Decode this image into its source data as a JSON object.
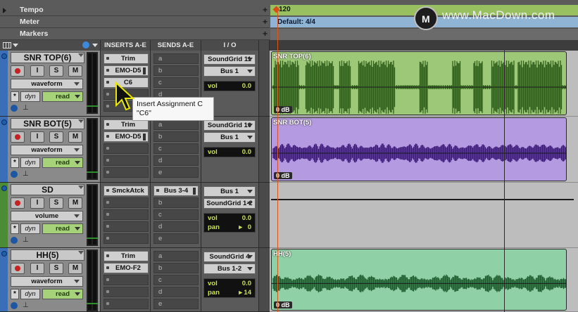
{
  "ruler": {
    "rows": [
      {
        "label": "Tempo"
      },
      {
        "label": "Meter"
      },
      {
        "label": "Markers"
      }
    ],
    "tempo_value": "120",
    "meter_value": "Default: 4/4",
    "add_glyph": "+"
  },
  "watermark": {
    "logo_letter": "M",
    "text": "www.MacDown.com"
  },
  "columns": {
    "inserts": "INSERTS A-E",
    "sends": "SENDS A-E",
    "io": "I / O"
  },
  "tracks": [
    {
      "name": "SNR TOP(6)",
      "color": "#3a6fb8",
      "view": "waveform",
      "dyn": "dyn",
      "automation": "read",
      "inserts": [
        "Trim",
        "EMO-D5",
        "C6",
        "",
        ""
      ],
      "sends": [
        "a",
        "b",
        "c",
        "d",
        "e"
      ],
      "io": [
        "SoundGrid 11",
        "Bus 1"
      ],
      "vol": [
        {
          "label": "vol",
          "value": "0.0"
        }
      ],
      "clip": {
        "name": "SNR TOP(6)",
        "gain": "0 dB",
        "color": "#9dc878",
        "wave_color": "#2f5e1b"
      }
    },
    {
      "name": "SNR BOT(5)",
      "color": "#3a6fb8",
      "view": "waveform",
      "dyn": "dyn",
      "automation": "read",
      "inserts": [
        "Trim",
        "EMO-D5",
        "",
        "",
        ""
      ],
      "sends": [
        "a",
        "b",
        "c",
        "d",
        "e"
      ],
      "io": [
        "SoundGrid 10",
        "Bus 1"
      ],
      "vol": [
        {
          "label": "vol",
          "value": "0.0"
        }
      ],
      "clip": {
        "name": "SNR BOT(5)",
        "gain": "0 dB",
        "color": "#b49ae0",
        "wave_color": "#3c1a7a"
      }
    },
    {
      "name": "SD",
      "color": "#4d8c36",
      "view": "volume",
      "dyn": "dyn",
      "automation": "read",
      "inserts": [
        "SmckAtck",
        "",
        "",
        "",
        ""
      ],
      "sends": [
        "Bus 3-4",
        "b",
        "c",
        "d",
        "e"
      ],
      "io": [
        "Bus 1",
        "SoundGrid 1-2"
      ],
      "vol": [
        {
          "label": "vol",
          "value": "0.0"
        },
        {
          "label": "pan",
          "value": "0"
        }
      ],
      "clip": null
    },
    {
      "name": "HH(5)",
      "color": "#3a6fb8",
      "view": "waveform",
      "dyn": "dyn",
      "automation": "read",
      "inserts": [
        "Trim",
        "EMO-F2",
        "",
        "",
        ""
      ],
      "sends": [
        "a",
        "b",
        "c",
        "d",
        "e"
      ],
      "io": [
        "SoundGrid 4",
        "Bus 1-2"
      ],
      "vol": [
        {
          "label": "vol",
          "value": "0.0"
        },
        {
          "label": "pan",
          "value": "14"
        }
      ],
      "clip": {
        "name": "HH(5)",
        "gain": "0 dB",
        "color": "#8fd0a6",
        "wave_color": "#1d5c2d"
      }
    }
  ],
  "track_buttons": {
    "record": "",
    "input": "I",
    "solo": "S",
    "mute": "M"
  },
  "tooltip": {
    "line1": "Insert Assignment C",
    "line2": "\"C6\""
  },
  "colors": {
    "tempo": "#98bf60",
    "meter": "#8fb4d4",
    "accent_read": "#a6d27a",
    "cursor": "#d6561c"
  }
}
